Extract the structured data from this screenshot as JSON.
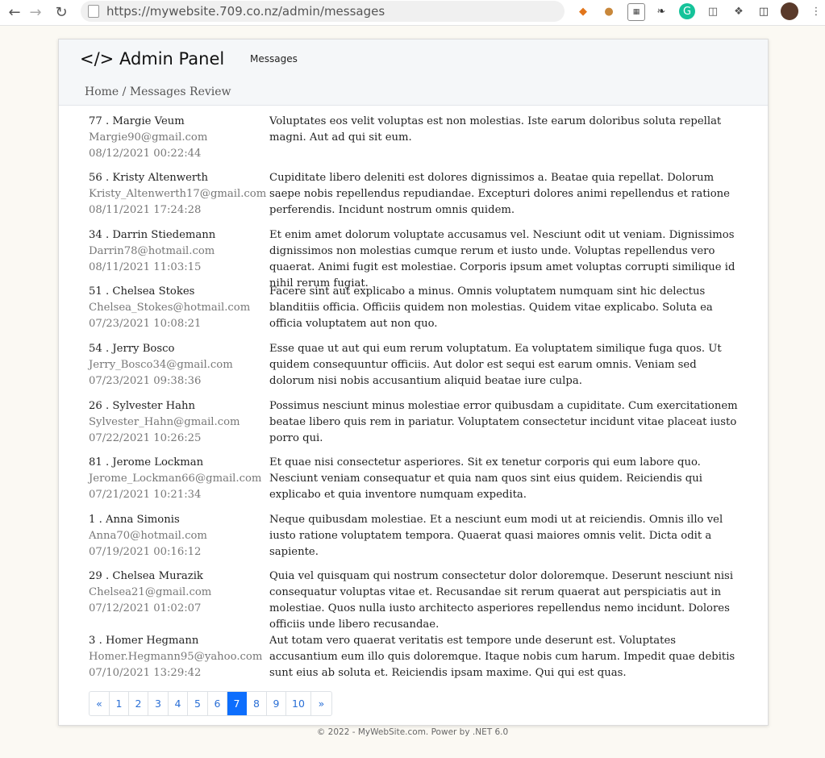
{
  "browser": {
    "url": "https://mywebsite.709.co.nz/admin/messages",
    "extensions": [
      "fox-icon",
      "cookie-icon",
      "page-icon",
      "feather-icon",
      "grammarly-icon",
      "tabs-icon",
      "puzzle-icon",
      "sidebar-icon",
      "avatar"
    ]
  },
  "header": {
    "brand": "</> Admin Panel",
    "nav_messages": "Messages"
  },
  "breadcrumb": "Home / Messages Review",
  "messages": [
    {
      "name": "77 . Margie Veum",
      "email": "Margie90@gmail.com",
      "date": "08/12/2021 00:22:44",
      "body": "Voluptates eos velit voluptas est non molestias. Iste earum doloribus soluta repellat magni. Aut ad qui sit eum."
    },
    {
      "name": "56 . Kristy Altenwerth",
      "email": "Kristy_Altenwerth17@gmail.com",
      "date": "08/11/2021 17:24:28",
      "body": "Cupiditate libero deleniti est dolores dignissimos a. Beatae quia repellat. Dolorum saepe nobis repellendus repudiandae. Excepturi dolores animi repellendus et ratione perferendis. Incidunt nostrum omnis quidem."
    },
    {
      "name": "34 . Darrin Stiedemann",
      "email": "Darrin78@hotmail.com",
      "date": "08/11/2021 11:03:15",
      "body": "Et enim amet dolorum voluptate accusamus vel. Nesciunt odit ut veniam. Dignissimos dignissimos non molestias cumque rerum et iusto unde. Voluptas repellendus vero quaerat. Animi fugit est molestiae. Corporis ipsum amet voluptas corrupti similique id nihil rerum fugiat."
    },
    {
      "name": "51 . Chelsea Stokes",
      "email": "Chelsea_Stokes@hotmail.com",
      "date": "07/23/2021 10:08:21",
      "body": "Facere sint aut explicabo a minus. Omnis voluptatem numquam sint hic delectus blanditiis officia. Officiis quidem non molestias. Quidem vitae explicabo. Soluta ea officia voluptatem aut non quo."
    },
    {
      "name": "54 . Jerry Bosco",
      "email": "Jerry_Bosco34@gmail.com",
      "date": "07/23/2021 09:38:36",
      "body": "Esse quae ut aut qui eum rerum voluptatum. Ea voluptatem similique fuga quos. Ut quidem consequuntur officiis. Aut dolor est sequi est earum omnis. Veniam sed dolorum nisi nobis accusantium aliquid beatae iure culpa."
    },
    {
      "name": "26 . Sylvester Hahn",
      "email": "Sylvester_Hahn@gmail.com",
      "date": "07/22/2021 10:26:25",
      "body": "Possimus nesciunt minus molestiae error quibusdam a cupiditate. Cum exercitationem beatae libero quis rem in pariatur. Voluptatem consectetur incidunt vitae placeat iusto porro qui."
    },
    {
      "name": "81 . Jerome Lockman",
      "email": "Jerome_Lockman66@gmail.com",
      "date": "07/21/2021 10:21:34",
      "body": "Et quae nisi consectetur asperiores. Sit ex tenetur corporis qui eum labore quo. Nesciunt veniam consequatur et quia nam quos sint eius quidem. Reiciendis qui explicabo et quia inventore numquam expedita."
    },
    {
      "name": "1 . Anna Simonis",
      "email": "Anna70@hotmail.com",
      "date": "07/19/2021 00:16:12",
      "body": "Neque quibusdam molestiae. Et a nesciunt eum modi ut at reiciendis. Omnis illo vel iusto ratione voluptatem tempora. Quaerat quasi maiores omnis velit. Dicta odit a sapiente."
    },
    {
      "name": "29 . Chelsea Murazik",
      "email": "Chelsea21@gmail.com",
      "date": "07/12/2021 01:02:07",
      "body": "Quia vel quisquam qui nostrum consectetur dolor doloremque. Deserunt nesciunt nisi consequatur voluptas vitae et. Recusandae sit rerum quaerat aut perspiciatis aut in molestiae. Quos nulla iusto architecto asperiores repellendus nemo incidunt. Dolores officiis unde libero recusandae."
    },
    {
      "name": "3 . Homer Hegmann",
      "email": "Homer.Hegmann95@yahoo.com",
      "date": "07/10/2021 13:29:42",
      "body": "Aut totam vero quaerat veritatis est tempore unde deserunt est. Voluptates accusantium eum illo quis doloremque. Itaque nobis cum harum. Impedit quae debitis sunt eius ab soluta et. Reiciendis ipsam maxime. Qui qui est quas."
    }
  ],
  "pagination": {
    "items": [
      "«",
      "1",
      "2",
      "3",
      "4",
      "5",
      "6",
      "7",
      "8",
      "9",
      "10",
      "»"
    ],
    "active": "7"
  },
  "footer": "© 2022 - MyWebSite.com. Power by .NET 6.0"
}
